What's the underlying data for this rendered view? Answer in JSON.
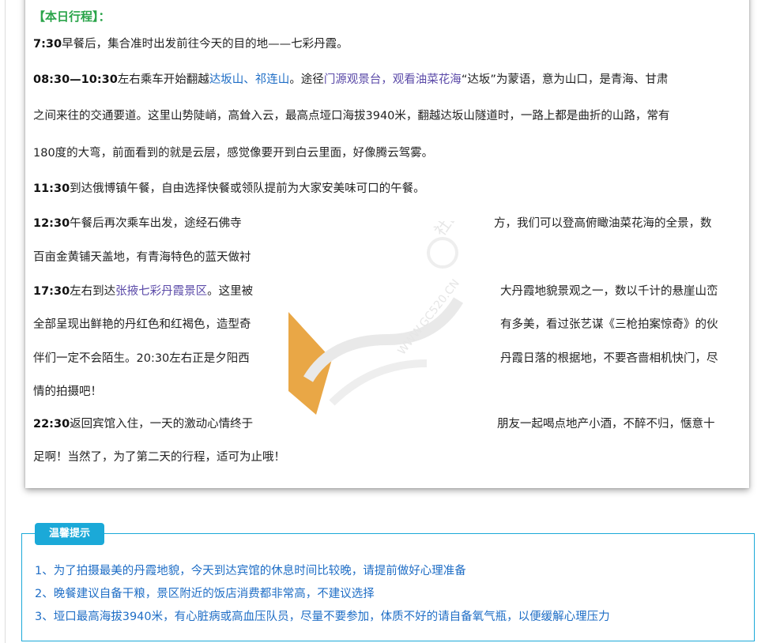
{
  "itinerary": {
    "title": "【本日行程】：",
    "lines": [
      {
        "time": "7:30",
        "text": "早餐后，集合准时出发前往今天的目的地——七彩丹霞。"
      },
      {
        "time": "08:30—10:30",
        "pre": "左右乘车开始翻越",
        "place1": "达坂山、祁连山",
        "mid": "。途径",
        "place2": "门源观景台，观看油菜花海",
        "post": "“达坂”为蒙语，意为山口，是青海、甘肃"
      },
      {
        "text": "之间来往的交通要道。这里山势陡峭，高耸入云，最高点垭口海拔3940米，翻越达坂山隧道时，一路上都是曲折的山路，常有"
      },
      {
        "text": "180度的大弯，前面看到的就是云层，感觉像要开到白云里面，好像腾云驾雾。"
      },
      {
        "time": "11:30",
        "text": "到达俄博镇午餐，自由选择快餐或领队提前为大家安美味可口的午餐。"
      },
      {
        "time": "12:30",
        "text": "午餐后再次乘车出发，途经石佛寺",
        "tail": "方，我们可以登高俯瞰油菜花海的全景，数"
      },
      {
        "text": "百亩金黄铺天盖地，有青海特色的蓝天做衬"
      },
      {
        "time": "17:30",
        "pre": "左右到达",
        "place1": "张掖七彩丹霞景区",
        "text": "。这里被",
        "tail": "大丹霞地貌景观之一，数以千计的悬崖山峦"
      },
      {
        "text": "全部呈现出鲜艳的丹红色和红褐色，造型奇",
        "tail": "有多美，看过张艺谋《三枪拍案惊奇》的伙"
      },
      {
        "text": "伴们一定不会陌生。20:30左右正是夕阳西",
        "tail": "丹霞日落的根据地，不要吝啬相机快门，尽"
      },
      {
        "text": "情的拍摄吧！"
      },
      {
        "time": "22:30",
        "text": "返回宾馆入住，一天的激动心情终于",
        "tail": "朋友一起喝点地产小酒，不醉不归，惬意十"
      },
      {
        "text": "足啊！当然了，为了第二天的行程，适可为止哦！"
      }
    ]
  },
  "watermark": {
    "cn": "社区",
    "url": "WWW.GC520.CN"
  },
  "tips": {
    "badge": "温馨提示",
    "items": [
      "1、为了拍摄最美的丹霞地貌，今天到达宾馆的休息时间比较晚，请提前做好心理准备",
      "2、晚餐建议自备干粮，景区附近的饭店消费都非常高，不建议选择",
      "3、垭口最高海拔3940米，有心脏病或高血压队员，尽量不要参加，体质不好的请自备氧气瓶，以便缓解心理压力"
    ]
  },
  "colors": {
    "title_green": "#2aa44a",
    "accent_blue": "#1ba9d8",
    "place_purple": "#5b4aa8",
    "tip_text": "#1f6ec6",
    "watermark_orange": "#e8a23c"
  }
}
